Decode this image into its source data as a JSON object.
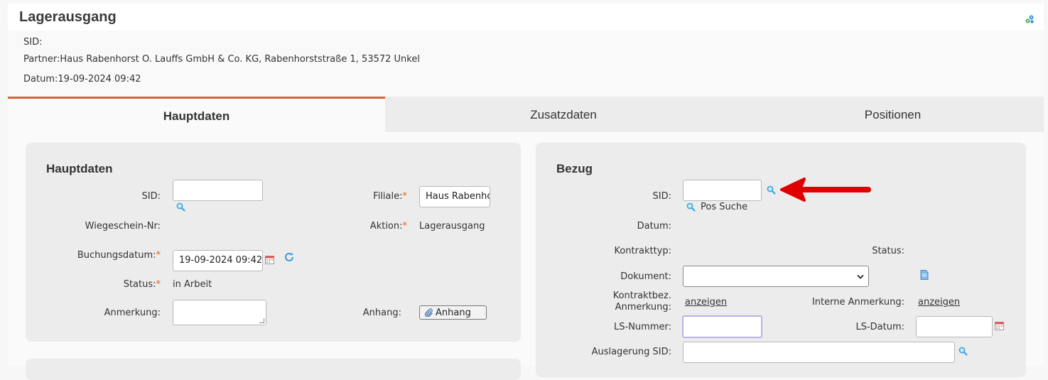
{
  "header": {
    "title": "Lagerausgang"
  },
  "info": {
    "sid": "SID:",
    "partner": "Partner:Haus Rabenhorst O. Lauffs GmbH & Co. KG, Rabenhorststraße 1, 53572 Unkel",
    "datum": "Datum:19-09-2024 09:42"
  },
  "tabs": [
    {
      "label": "Hauptdaten",
      "active": true
    },
    {
      "label": "Zusatzdaten",
      "active": false
    },
    {
      "label": "Positionen",
      "active": false
    }
  ],
  "hauptdaten": {
    "title": "Hauptdaten",
    "sid_label": "SID:",
    "sid_value": "",
    "wiegeschein_label": "Wiegeschein-Nr:",
    "buchungsdatum_label": "Buchungsdatum:",
    "buchungsdatum_value": "19-09-2024 09:42",
    "status_label": "Status:",
    "status_value": "in Arbeit",
    "anmerkung_label": "Anmerkung:",
    "filiale_label": "Filiale:",
    "filiale_value": "Haus Rabenhorst",
    "aktion_label": "Aktion:",
    "aktion_value": "Lagerausgang",
    "anhang_label": "Anhang:",
    "anhang_button": "Anhang",
    "required_mark": "*"
  },
  "bezug": {
    "title": "Bezug",
    "sid_label": "SID:",
    "pos_suche": "Pos Suche",
    "datum_label": "Datum:",
    "kontrakttyp_label": "Kontrakttyp:",
    "status_label": "Status:",
    "dokument_label": "Dokument:",
    "kontraktbez_label_1": "Kontraktbez.",
    "kontraktbez_label_2": "Anmerkung:",
    "kontraktbez_link": "anzeigen",
    "interne_label": "Interne Anmerkung:",
    "interne_link": "anzeigen",
    "ls_nummer_label": "LS-Nummer:",
    "ls_datum_label": "LS-Datum:",
    "auslagerung_label": "Auslagerung SID:"
  },
  "colors": {
    "accent": "#d86436",
    "required": "#e0661e",
    "arrow": "#e00000",
    "search_icon": "#3aa6e0"
  }
}
